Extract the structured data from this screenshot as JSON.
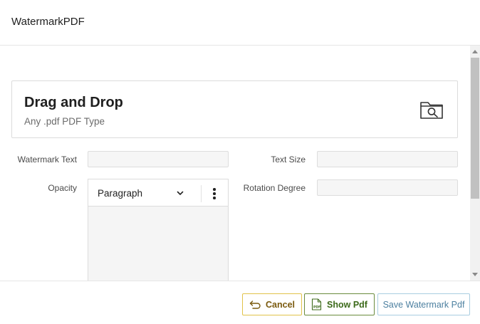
{
  "dialog": {
    "title": "WatermarkPDF"
  },
  "dropzone": {
    "title": "Drag and Drop",
    "subtitle": "Any .pdf PDF Type",
    "icon": "folder-search-icon"
  },
  "form": {
    "watermark_text": {
      "label": "Watermark Text",
      "value": ""
    },
    "text_size": {
      "label": "Text Size",
      "value": ""
    },
    "opacity": {
      "label": "Opacity"
    },
    "rotation_degree": {
      "label": "Rotation Degree",
      "value": ""
    },
    "editor": {
      "format_value": "Paragraph",
      "more_icon": "more-vertical-icon"
    }
  },
  "footer": {
    "cancel_label": "Cancel",
    "show_pdf_label": "Show Pdf",
    "save_label": "Save Watermark Pdf"
  },
  "colors": {
    "cancel_border": "#e1c24a",
    "show_border": "#6a8b3d",
    "save_border": "#a9cde0"
  }
}
